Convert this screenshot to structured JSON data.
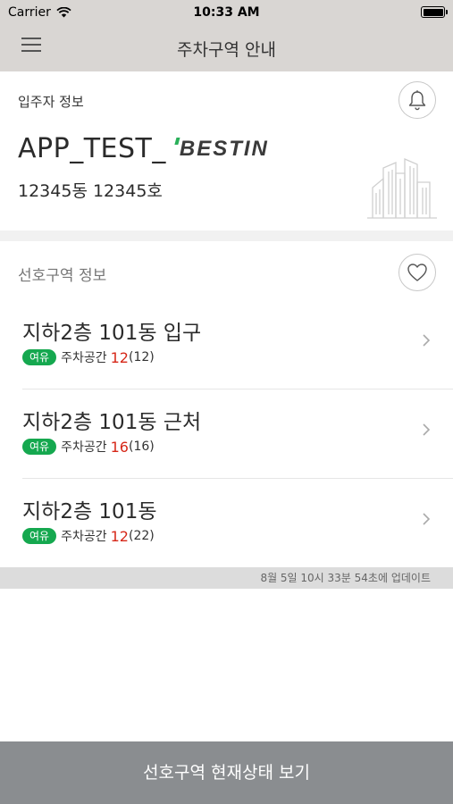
{
  "status_bar": {
    "carrier": "Carrier",
    "time": "10:33 AM"
  },
  "header": {
    "title": "주차구역 안내"
  },
  "resident_info": {
    "label": "입주자 정보",
    "user_name": "APP_TEST_",
    "brand": "BESTIN",
    "unit": "12345동 12345호"
  },
  "preferred": {
    "label": "선호구역 정보",
    "items": [
      {
        "name": "지하2층 101동 입구",
        "badge": "여유",
        "space_label": "주차공간",
        "available": "12",
        "total": "(12)"
      },
      {
        "name": "지하2층 101동 근처",
        "badge": "여유",
        "space_label": "주차공간",
        "available": "16",
        "total": "(16)"
      },
      {
        "name": "지하2층 101동",
        "badge": "여유",
        "space_label": "주차공간",
        "available": "12",
        "total": "(22)"
      }
    ]
  },
  "update_text": "8월 5일 10시 33분 54초에 업데이트",
  "bottom_button": {
    "label": "선호구역 현재상태 보기"
  },
  "icons": [
    "wifi-icon",
    "battery-icon",
    "menu-icon",
    "bell-icon",
    "heart-icon",
    "buildings-icon",
    "chevron-right-icon"
  ],
  "colors": {
    "accent_green": "#15a84f",
    "count_red": "#d62718",
    "header_bg": "#d9d6d3",
    "button_bg": "#8a8d90"
  }
}
